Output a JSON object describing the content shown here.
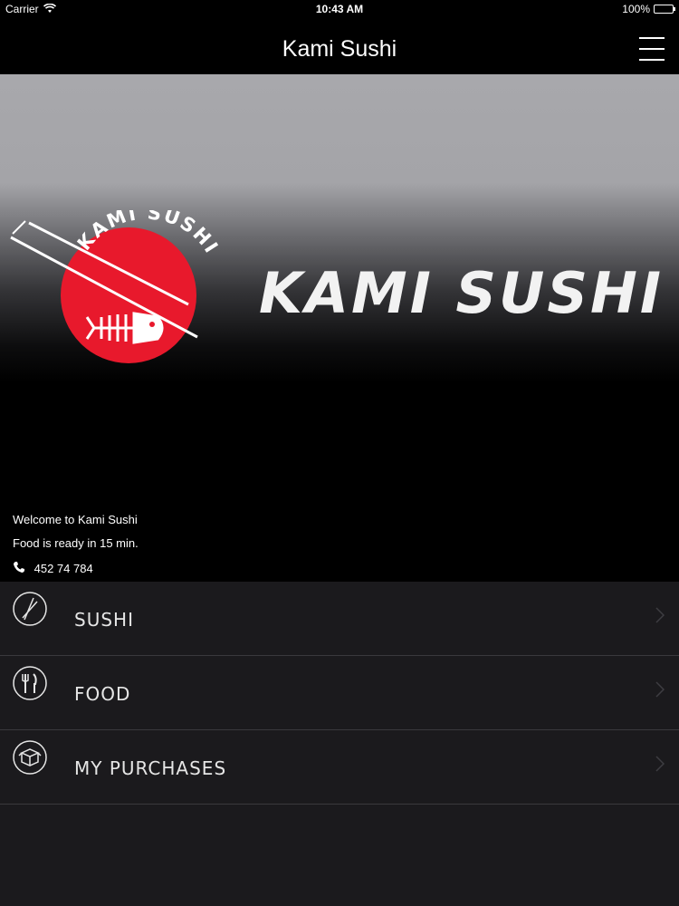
{
  "status_bar": {
    "carrier": "Carrier",
    "time": "10:43 AM",
    "battery": "100%"
  },
  "nav": {
    "title": "Kami Sushi"
  },
  "hero": {
    "logo_arc_text": "KAMI SUSHI",
    "logo_text": "KAMI SUSHI",
    "welcome": "Welcome to Kami Sushi",
    "ready": "Food is ready in 15 min.",
    "phone": "452 74 784"
  },
  "menu": [
    {
      "label": "SUSHI",
      "icon": "chopsticks-icon"
    },
    {
      "label": "FOOD",
      "icon": "fork-knife-icon"
    },
    {
      "label": "MY PURCHASES",
      "icon": "box-icon"
    }
  ],
  "colors": {
    "logo_red": "#e8192c",
    "background": "#1b1a1d",
    "nav_background": "#000000"
  }
}
